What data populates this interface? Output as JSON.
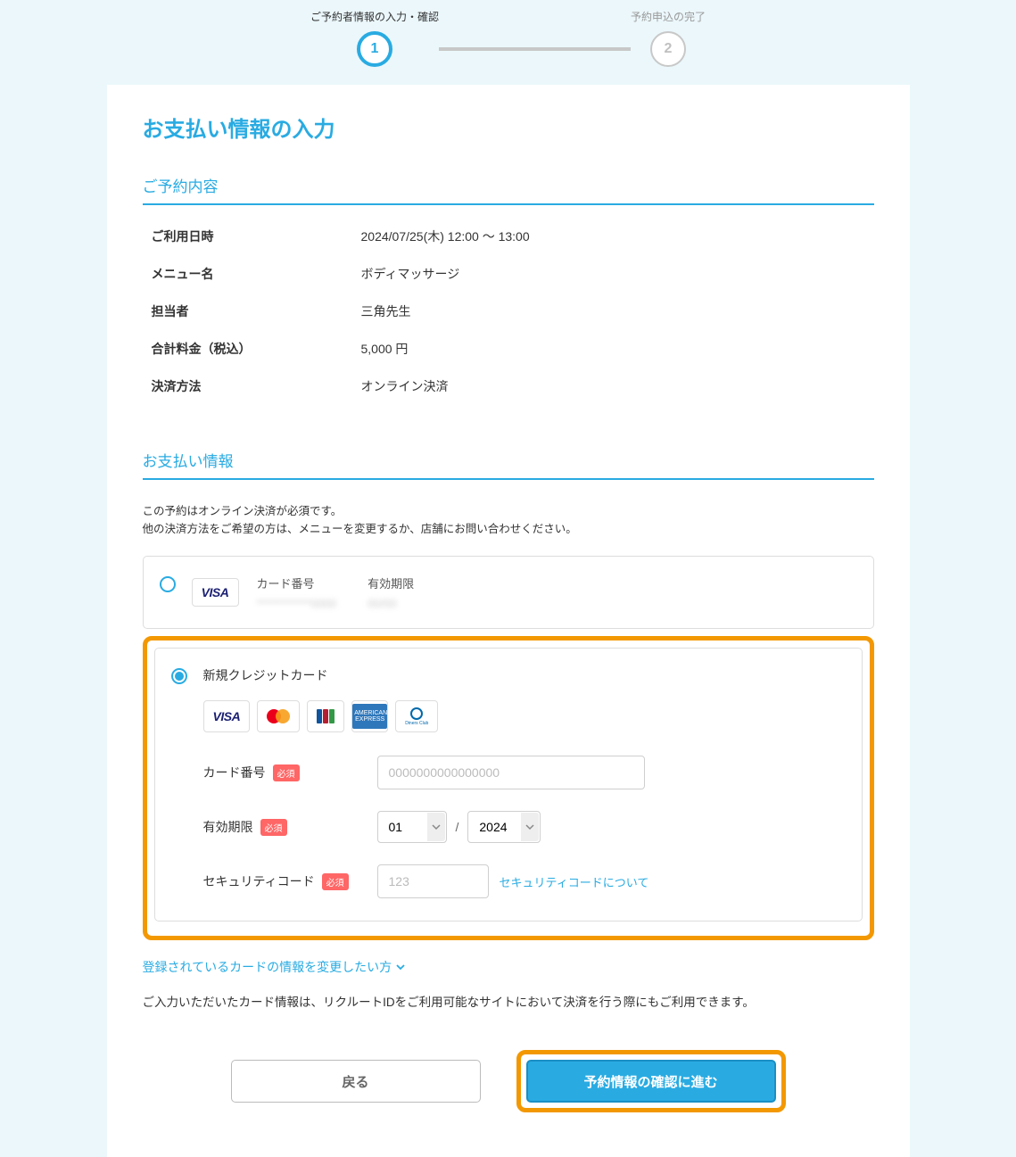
{
  "stepper": {
    "step1": {
      "label": "ご予約者情報の入力・確認",
      "num": "1"
    },
    "step2": {
      "label": "予約申込の完了",
      "num": "2"
    }
  },
  "page_title": "お支払い情報の入力",
  "reservation": {
    "heading": "ご予約内容",
    "rows": {
      "datetime": {
        "label": "ご利用日時",
        "value": "2024/07/25(木) 12:00 ～ 13:00"
      },
      "menu": {
        "label": "メニュー名",
        "value": "ボディマッサージ"
      },
      "staff": {
        "label": "担当者",
        "value": "三角先生"
      },
      "price": {
        "label": "合計料金（税込）",
        "value": "5,000 円"
      },
      "method": {
        "label": "決済方法",
        "value": "オンライン決済"
      }
    }
  },
  "payment": {
    "heading": "お支払い情報",
    "note_line1": "この予約はオンライン決済が必須です。",
    "note_line2": "他の決済方法をご希望の方は、メニューを変更するか、店舗にお問い合わせください。",
    "saved_card": {
      "card_number_label": "カード番号",
      "card_number_masked": "************0000",
      "expiry_label": "有効期限",
      "expiry_masked": "00/00"
    },
    "new_card": {
      "title": "新規クレジットカード",
      "card_number_label": "カード番号",
      "card_number_placeholder": "0000000000000000",
      "expiry_label": "有効期限",
      "month": "01",
      "year": "2024",
      "cvv_label": "セキュリティコード",
      "cvv_placeholder": "123",
      "cvv_help": "セキュリティコードについて",
      "required_badge": "必須",
      "sep": "/"
    },
    "change_saved_link": "登録されているカードの情報を変更したい方",
    "disclosure": "ご入力いただいたカード情報は、リクルートIDをご利用可能なサイトにおいて決済を行う際にもご利用できます。"
  },
  "buttons": {
    "back": "戻る",
    "proceed": "予約情報の確認に進む"
  },
  "colors": {
    "accent": "#29abe2",
    "highlight": "#f39800",
    "required": "#ff6666"
  }
}
